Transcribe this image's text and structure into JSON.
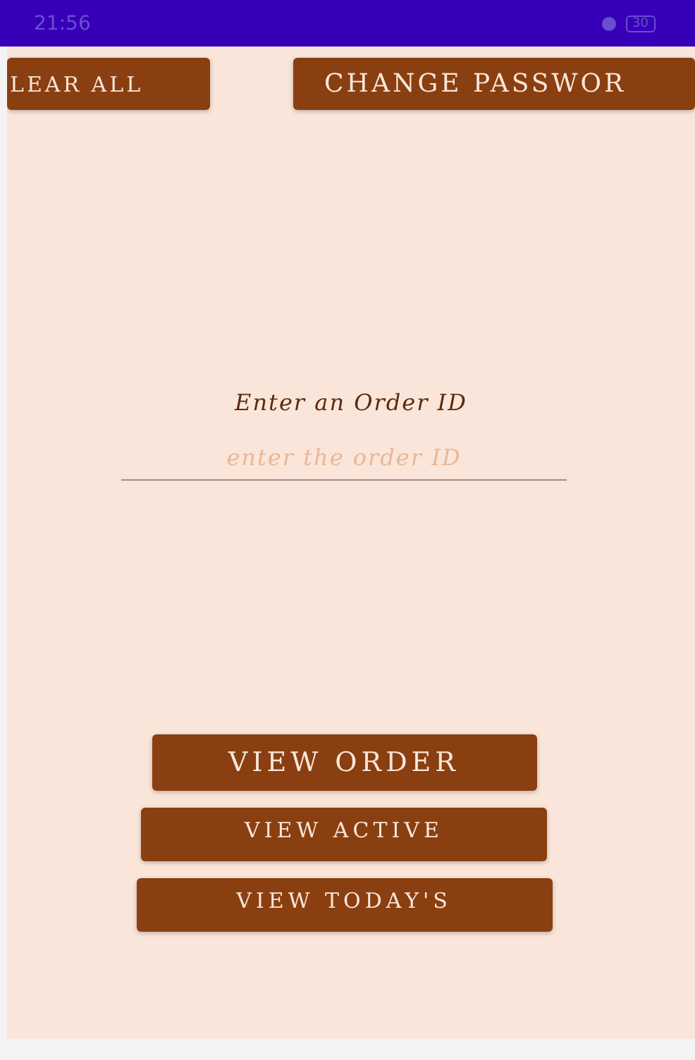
{
  "status_bar": {
    "time": "21:56",
    "battery": "30"
  },
  "top_buttons": [
    "LEAR ALL",
    "CHANGE PASSWOR"
  ],
  "order_form": {
    "label": "Enter an Order ID",
    "placeholder": "enter the order ID"
  },
  "actions": [
    {
      "label": "VIEW ORDER",
      "kind": "large"
    },
    {
      "label": "VIEW ACTIVE",
      "kind": "cut"
    },
    {
      "label": "VIEW TODAY'S",
      "kind": "cut"
    }
  ]
}
